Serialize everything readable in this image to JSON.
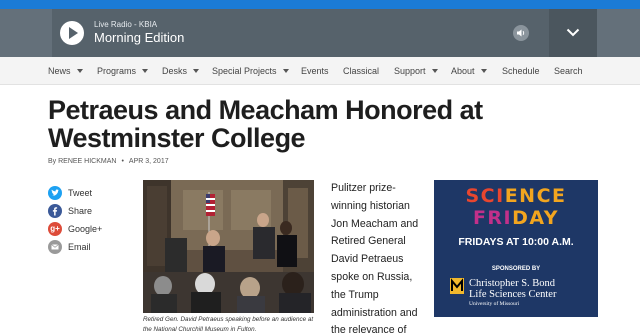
{
  "player": {
    "station": "Live Radio - KBIA",
    "program": "Morning Edition",
    "play_icon": "play-icon",
    "volume_icon": "volume-icon",
    "expand_icon": "chevron-down-icon",
    "colors": {
      "top_bar": "#1b7bd6",
      "player_bg": "#64707a"
    }
  },
  "nav": {
    "items": [
      {
        "label": "News",
        "dropdown": true
      },
      {
        "label": "Programs",
        "dropdown": true
      },
      {
        "label": "Desks",
        "dropdown": true
      },
      {
        "label": "Special Projects",
        "dropdown": true
      },
      {
        "label": "Events",
        "dropdown": false
      },
      {
        "label": "Classical",
        "dropdown": false
      },
      {
        "label": "Support",
        "dropdown": true
      },
      {
        "label": "About",
        "dropdown": true
      },
      {
        "label": "Schedule",
        "dropdown": false
      },
      {
        "label": "Search",
        "dropdown": false
      }
    ]
  },
  "article": {
    "headline": "Petraeus and Meacham Honored at Westminster College",
    "byline_author": "By RENEE HICKMAN",
    "byline_separator": "•",
    "date": "APR 3, 2017",
    "photo_caption": "Retired Gen. David Petraeus speaking before an audience at the National Churchill Museum in Fulton.",
    "body_excerpt": "Pulitzer prize-winning historian Jon Meacham and Retired General David Petraeus spoke on Russia, the Trump administration and the relevance of"
  },
  "share": {
    "items": [
      {
        "label": "Tweet",
        "icon": "twitter-icon",
        "color": "#1da1f2"
      },
      {
        "label": "Share",
        "icon": "facebook-icon",
        "color": "#3b5998"
      },
      {
        "label": "Google+",
        "icon": "google-plus-icon",
        "color": "#dd4b39"
      },
      {
        "label": "Email",
        "icon": "email-icon",
        "color": "#9a9a9a"
      }
    ]
  },
  "ad": {
    "title_line1": "SCIENCE",
    "title_line2": "FRIDAY",
    "schedule": "FRIDAYS AT 10:00 A.M.",
    "sponsored_by": "SPONSORED BY",
    "sponsor_line1": "Christopher S. Bond",
    "sponsor_line2": "Life Sciences Center",
    "sponsor_line3": "University of Missouri",
    "colors": {
      "background": "#1e3766",
      "sci": "#e8462f",
      "ence": "#f2a51f",
      "fri": "#c2308a"
    }
  }
}
